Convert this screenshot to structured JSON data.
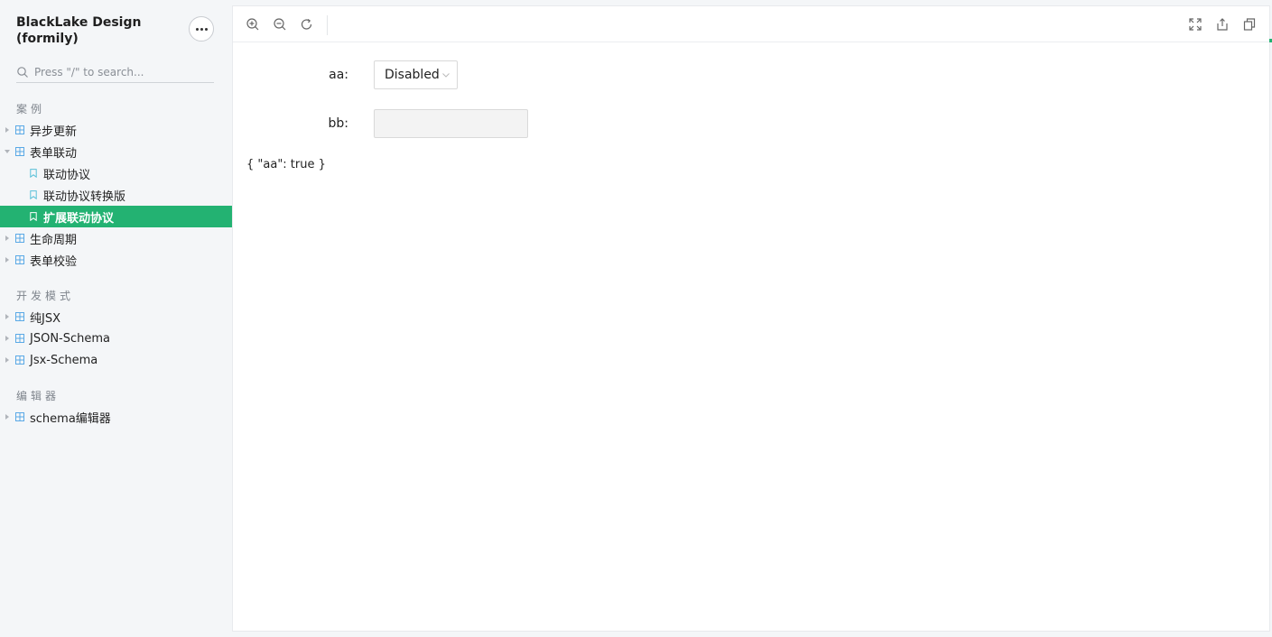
{
  "sidebar": {
    "brand": "BlackLake Design (formily)",
    "search_placeholder": "Press \"/\" to search...",
    "groups": [
      {
        "title": "案例"
      },
      {
        "title": "开发模式"
      },
      {
        "title": "编辑器"
      }
    ],
    "items": [
      {
        "label": "异步更新"
      },
      {
        "label": "表单联动"
      },
      {
        "label": "联动协议"
      },
      {
        "label": "联动协议转换版"
      },
      {
        "label": "扩展联动协议"
      },
      {
        "label": "生命周期"
      },
      {
        "label": "表单校验"
      },
      {
        "label": "纯JSX"
      },
      {
        "label": "JSON-Schema"
      },
      {
        "label": "Jsx-Schema"
      },
      {
        "label": "schema编辑器"
      }
    ]
  },
  "form": {
    "aa_label": "aa:",
    "aa_value": "Disabled",
    "bb_label": "bb:",
    "output": "{ \"aa\": true }"
  },
  "colors": {
    "accent": "#23b272",
    "icon": "#5aa9e6"
  }
}
